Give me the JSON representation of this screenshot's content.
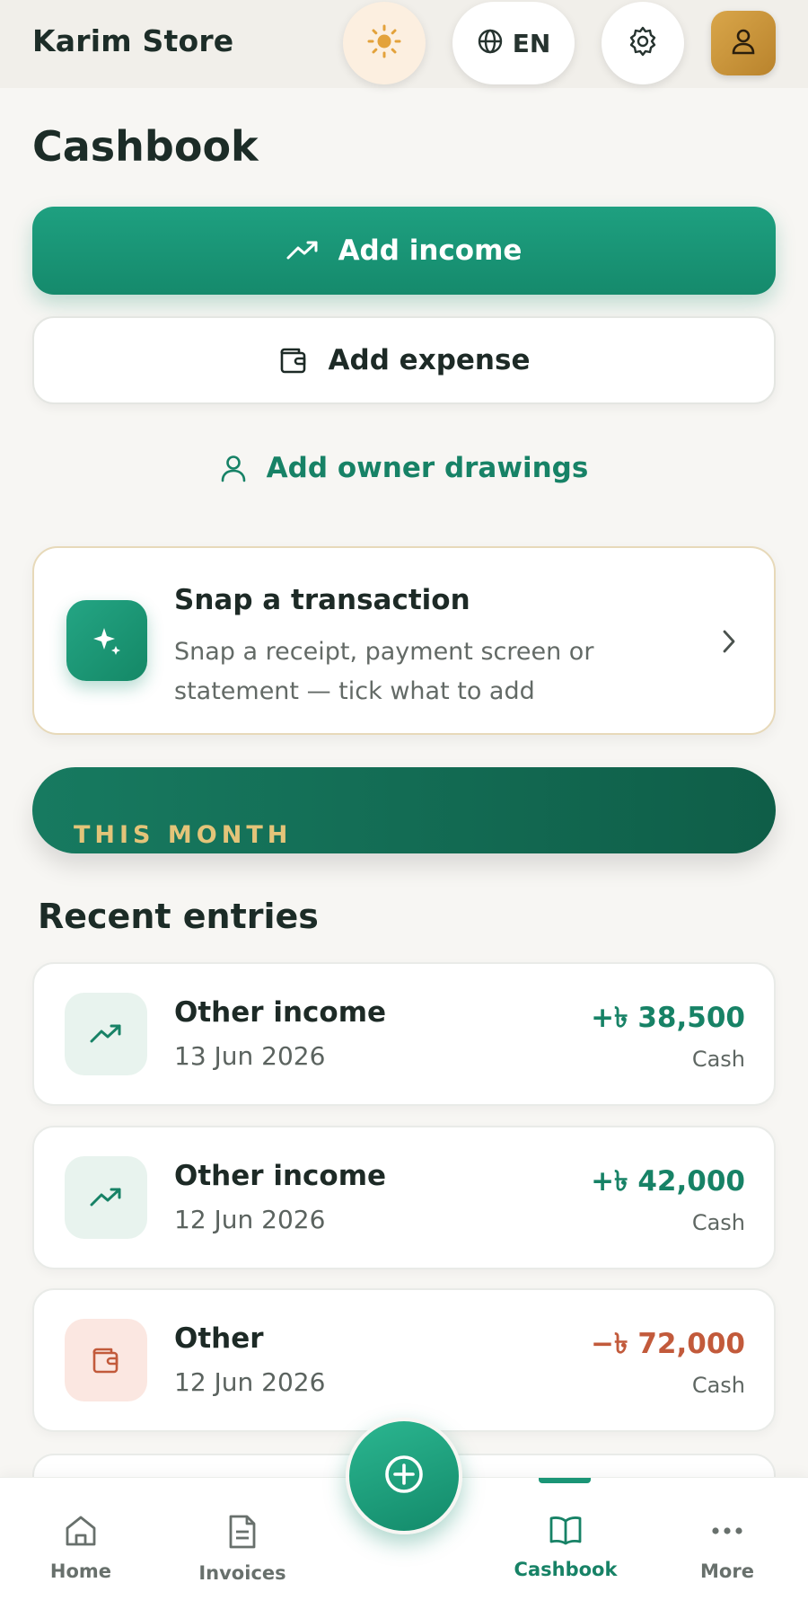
{
  "header": {
    "store_name": "Karim Store",
    "language_label": "EN",
    "icons": [
      "sun-icon",
      "globe-icon",
      "gear-icon",
      "user-icon"
    ]
  },
  "page": {
    "title": "Cashbook"
  },
  "actions": {
    "add_income": "Add income",
    "add_expense": "Add expense",
    "add_owner_drawings": "Add owner drawings"
  },
  "snap": {
    "title": "Snap a transaction",
    "description": "Snap a receipt, payment screen or statement — tick what to add"
  },
  "month_banner": {
    "label": "THIS MONTH"
  },
  "recent": {
    "title": "Recent entries",
    "entries": [
      {
        "name": "Other income",
        "date": "13 Jun 2026",
        "amount": "+৳ 38,500",
        "method": "Cash",
        "type": "income"
      },
      {
        "name": "Other income",
        "date": "12 Jun 2026",
        "amount": "+৳ 42,000",
        "method": "Cash",
        "type": "income"
      },
      {
        "name": "Other",
        "date": "12 Jun 2026",
        "amount": "−৳ 72,000",
        "method": "Cash",
        "type": "expense"
      }
    ]
  },
  "nav": {
    "items": [
      {
        "label": "Home",
        "icon": "home-icon"
      },
      {
        "label": "Invoices",
        "icon": "document-icon"
      },
      {
        "label": "Cashbook",
        "icon": "book-icon",
        "active": true
      },
      {
        "label": "More",
        "icon": "more-icon"
      }
    ],
    "fab_icon": "plus-circle-icon"
  },
  "colors": {
    "brand_green": "#178266",
    "income": "#178266",
    "expense": "#c25a3b",
    "accent_gold": "#e3c479",
    "background": "#f7f6f3"
  }
}
